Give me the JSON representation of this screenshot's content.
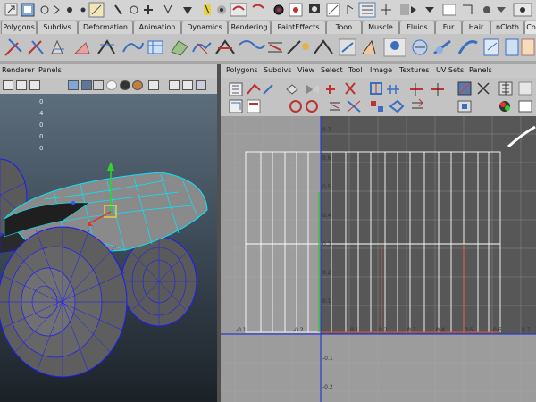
{
  "shelf_tabs": [
    "Polygons",
    "Subdivs",
    "Deformation",
    "Animation",
    "Dynamics",
    "Rendering",
    "PaintEffects",
    "Toon",
    "Muscle",
    "Fluids",
    "Fur",
    "Hair",
    "nCloth",
    "Co"
  ],
  "top_icons": [
    "move-tool-icon",
    "select-tool-icon",
    "lasso-icon",
    "snap-grid-icon",
    "snap-curve-icon",
    "snap-point-icon",
    "render-icon",
    "ipr-render-icon",
    "render-settings-icon",
    "hypershade-icon"
  ],
  "shelf_icons": [
    "poly-sphere-icon",
    "poly-cube-icon",
    "poly-cylinder-icon",
    "poly-cone-icon",
    "poly-plane-icon",
    "poly-torus-icon",
    "combine-icon",
    "separate-icon",
    "smooth-icon",
    "extrude-icon",
    "bridge-icon",
    "merge-icon",
    "append-icon",
    "split-poly-icon",
    "insert-edge-loop-icon",
    "sculpt-icon",
    "poly-count-icon",
    "uv-texture-editor-icon",
    "planar-mapping-icon",
    "cylindrical-mapping-icon",
    "spherical-mapping-icon",
    "automatic-mapping-icon"
  ],
  "perspective_panel": {
    "menu": [
      "Renderer",
      "Panels"
    ],
    "hud_values": [
      "0",
      "4",
      "0",
      "0",
      "0"
    ]
  },
  "uv_editor": {
    "menu": [
      "Polygons",
      "Subdivs",
      "View",
      "Select",
      "Tool",
      "Image",
      "Textures",
      "UV Sets",
      "Panels"
    ],
    "axis_labels": {
      "top": [
        "0.7",
        "0.6",
        "0.5",
        "0.4",
        "0.3",
        "0.2",
        "0.1"
      ],
      "bottom_row": [
        "-0.1",
        "-0.2",
        "0.1",
        "0.2",
        "0.3",
        "0.4",
        "0.5",
        "0.6",
        "0.7"
      ],
      "below": [
        "-0.1",
        "-0.2"
      ]
    }
  },
  "colors": {
    "uv_space_bg": "#575757",
    "outside_bg": "#9c9c9c",
    "grid_line": "#b8b8b8",
    "uv_shell": "#ffffff",
    "uv_highlight": "#e05a3a",
    "axis_u": "#2a3cc8",
    "axis_v": "#28c828",
    "wire": "#1a1aff",
    "selected_wire": "#00e8ff"
  }
}
